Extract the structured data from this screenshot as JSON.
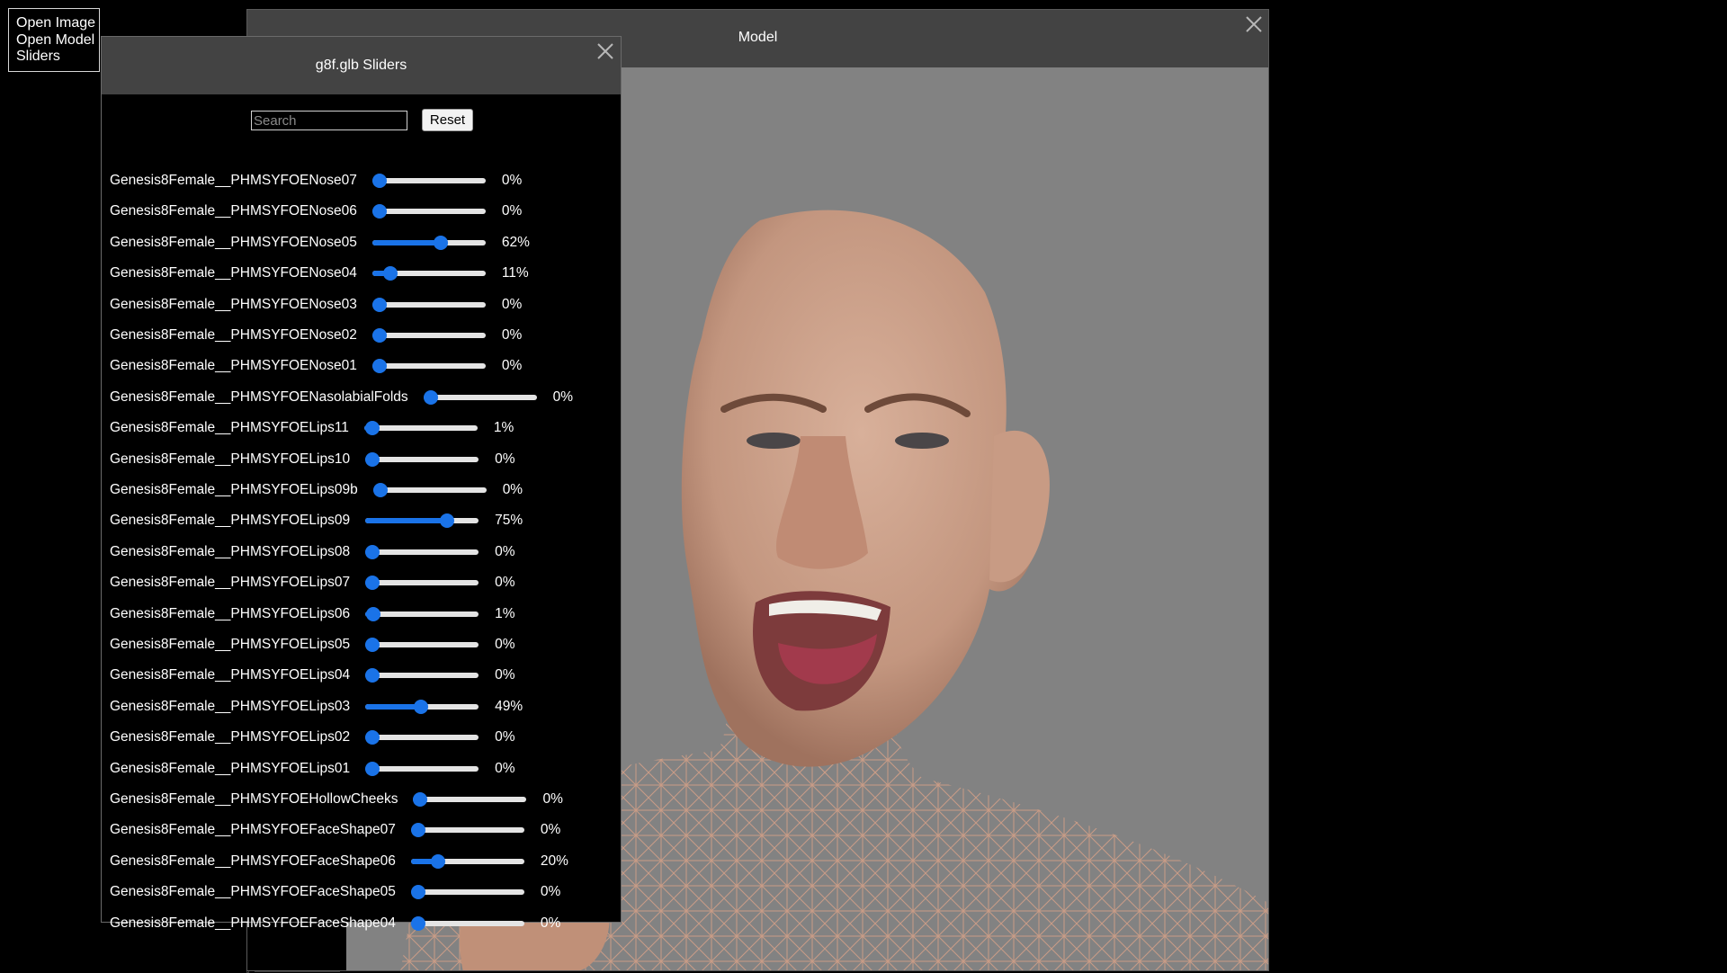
{
  "menu": {
    "items": [
      "Open Image",
      "Open Model",
      "Sliders"
    ]
  },
  "model_window": {
    "title": "Model"
  },
  "sliders_panel": {
    "title": "g8f.glb Sliders",
    "search_placeholder": "Search",
    "search_value": "",
    "reset_label": "Reset",
    "sliders": [
      {
        "label": "Genesis8Female__PHMSYFOENose07",
        "value": 0,
        "display": "0%"
      },
      {
        "label": "Genesis8Female__PHMSYFOENose06",
        "value": 0,
        "display": "0%"
      },
      {
        "label": "Genesis8Female__PHMSYFOENose05",
        "value": 62,
        "display": "62%"
      },
      {
        "label": "Genesis8Female__PHMSYFOENose04",
        "value": 11,
        "display": "11%"
      },
      {
        "label": "Genesis8Female__PHMSYFOENose03",
        "value": 0,
        "display": "0%"
      },
      {
        "label": "Genesis8Female__PHMSYFOENose02",
        "value": 0,
        "display": "0%"
      },
      {
        "label": "Genesis8Female__PHMSYFOENose01",
        "value": 0,
        "display": "0%"
      },
      {
        "label": "Genesis8Female__PHMSYFOENasolabialFolds",
        "value": 0,
        "display": "0%"
      },
      {
        "label": "Genesis8Female__PHMSYFOELips11",
        "value": 1,
        "display": "1%"
      },
      {
        "label": "Genesis8Female__PHMSYFOELips10",
        "value": 0,
        "display": "0%"
      },
      {
        "label": "Genesis8Female__PHMSYFOELips09b",
        "value": 0,
        "display": "0%"
      },
      {
        "label": "Genesis8Female__PHMSYFOELips09",
        "value": 75,
        "display": "75%"
      },
      {
        "label": "Genesis8Female__PHMSYFOELips08",
        "value": 0,
        "display": "0%"
      },
      {
        "label": "Genesis8Female__PHMSYFOELips07",
        "value": 0,
        "display": "0%"
      },
      {
        "label": "Genesis8Female__PHMSYFOELips06",
        "value": 1,
        "display": "1%"
      },
      {
        "label": "Genesis8Female__PHMSYFOELips05",
        "value": 0,
        "display": "0%"
      },
      {
        "label": "Genesis8Female__PHMSYFOELips04",
        "value": 0,
        "display": "0%"
      },
      {
        "label": "Genesis8Female__PHMSYFOELips03",
        "value": 49,
        "display": "49%"
      },
      {
        "label": "Genesis8Female__PHMSYFOELips02",
        "value": 0,
        "display": "0%"
      },
      {
        "label": "Genesis8Female__PHMSYFOELips01",
        "value": 0,
        "display": "0%"
      },
      {
        "label": "Genesis8Female__PHMSYFOEHollowCheeks",
        "value": 0,
        "display": "0%"
      },
      {
        "label": "Genesis8Female__PHMSYFOEFaceShape07",
        "value": 0,
        "display": "0%"
      },
      {
        "label": "Genesis8Female__PHMSYFOEFaceShape06",
        "value": 20,
        "display": "20%"
      },
      {
        "label": "Genesis8Female__PHMSYFOEFaceShape05",
        "value": 0,
        "display": "0%"
      },
      {
        "label": "Genesis8Female__PHMSYFOEFaceShape04",
        "value": 0,
        "display": "0%"
      }
    ]
  },
  "colors": {
    "accent": "#1a73e8",
    "header": "#434343",
    "viewport": "#828282",
    "skin": "#c79a82"
  }
}
